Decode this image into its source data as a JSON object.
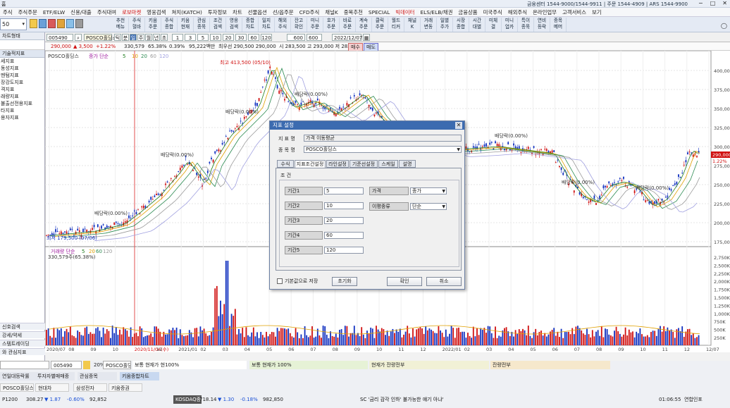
{
  "window": {
    "title": "홈",
    "center_info": "금융센터 1544-9000/1544-9911 | 주문 1544-4909 | ARS 1544-9900"
  },
  "menu": [
    "주식",
    "주식주문",
    "ETF/ELW",
    "신용/대출",
    "주식대여",
    "로보마켓",
    "영웅검색",
    "쳐치(KATCH)",
    "투자정보",
    "차트",
    "선물옵션",
    "선/옵주문",
    "CFD주식",
    "채널K",
    "중목추천",
    "SPECIAL",
    "빅데이터",
    "ELS/ELB/채권",
    "금융상품",
    "미국주식",
    "해외주식",
    "온라인업무",
    "고객서비스",
    "보기"
  ],
  "menu_red": [
    "로보마켓",
    "빅데이터"
  ],
  "toolbar": [
    {
      "l1": "추천",
      "l2": "메뉴"
    },
    {
      "l1": "주식",
      "l2": "혈바"
    },
    {
      "l1": "키움",
      "l2": "주문"
    },
    {
      "l1": "주식",
      "l2": "종합"
    },
    {
      "l1": "키움",
      "l2": "현재"
    },
    {
      "l1": "관심",
      "l2": "종목"
    },
    {
      "l1": "조건",
      "l2": "검색"
    },
    {
      "l1": "영웅",
      "l2": "검색"
    },
    {
      "l1": "종합",
      "l2": "차트"
    },
    {
      "l1": "일지",
      "l2": "차트"
    },
    {
      "l1": "해외",
      "l2": "주식"
    },
    {
      "l1": "잔고",
      "l2": "확인"
    },
    {
      "l1": "미니",
      "l2": "주문"
    },
    {
      "l1": "호가",
      "l2": "주문"
    },
    {
      "l1": "바로",
      "l2": "주문"
    },
    {
      "l1": "계속",
      "l2": "주문"
    },
    {
      "l1": "클릭",
      "l2": "주문"
    },
    {
      "l1": "월드",
      "l2": "티커"
    },
    {
      "l1": "채널",
      "l2": "K"
    },
    {
      "l1": "거래",
      "l2": "변동"
    },
    {
      "l1": "일별",
      "l2": "주가"
    },
    {
      "l1": "시장",
      "l2": "종합"
    },
    {
      "l1": "시간",
      "l2": "대별"
    },
    {
      "l1": "미체",
      "l2": "결"
    },
    {
      "l1": "미니",
      "l2": "업카"
    },
    {
      "l1": "특이",
      "l2": "종목"
    },
    {
      "l1": "연비",
      "l2": "등락"
    },
    {
      "l1": "종목",
      "l2": "메머"
    }
  ],
  "left_panel": {
    "head": "기술적지표",
    "items": [
      "세지표",
      "동성지표",
      "멘텀지표",
      "장강도지표",
      "격지표",
      "래량지표",
      "불출선전용지표",
      "타지표",
      "용자지표"
    ],
    "tab_top": "차트형태",
    "bottom": [
      "신호검색",
      "강세/약세",
      "스템트레이딩",
      "와 관심지표"
    ],
    "screen_no": "50"
  },
  "chart_controls": {
    "code": "005490",
    "stock_name": "POSCO홀딩스",
    "periods": [
      "틱",
      "분",
      "일",
      "주",
      "월",
      "년",
      "초"
    ],
    "intervals": [
      "1",
      "3",
      "5",
      "10",
      "20",
      "30",
      "60",
      "120"
    ],
    "count": "600",
    "count_total": "600",
    "date": "2022/12/07"
  },
  "price_bar": {
    "price": "290,000",
    "change": "▲ 3,500",
    "pct": "+1.22%",
    "volume": "330,579",
    "vol_ratio": "65.38%",
    "turnover": "0.39%",
    "amount": "95,222백만",
    "best_bid": "최우선 290,500 290,000",
    "ohl": "시 283,500 고 293,000 저 282,500",
    "buy_btn": "매수",
    "sell_btn": "매도"
  },
  "price_legend": {
    "name": "POSCO홀딩스",
    "type": "종가 단순",
    "ma": [
      "5",
      "10",
      "20",
      "60",
      "120"
    ]
  },
  "volume_legend": {
    "type": "거래량 단순",
    "ma": [
      "5",
      "20",
      "60",
      "120"
    ],
    "value": "330,579주(65.38%)"
  },
  "price_axis": [
    "400,000",
    "375,000",
    "350,000",
    "325,000",
    "300,000",
    "275,000",
    "250,000",
    "225,000",
    "200,000",
    "175,000"
  ],
  "volume_axis": [
    "2,750K",
    "2,500K",
    "2,250K",
    "2,000K",
    "1,750K",
    "1,500K",
    "1,250K",
    "1,000K",
    "750K",
    "500K",
    "250K"
  ],
  "current_price_tag": "290,000",
  "current_pct_tag": "1.22%",
  "date_axis": [
    "2020/07",
    "08",
    "09",
    "10",
    "2020/11/04(수)",
    "12",
    "2021/01",
    "02",
    "03",
    "04",
    "05",
    "06",
    "07",
    "08",
    "09",
    "10",
    "11",
    "12",
    "2022/01",
    "02",
    "03",
    "04",
    "05",
    "06",
    "07",
    "08",
    "09",
    "10",
    "11",
    "12",
    "12/07"
  ],
  "annotations": {
    "high": "최고 413,500 (05/10)",
    "low": "최저 179,500 (07/06)",
    "div": "배당락(0.00%)"
  },
  "dialog": {
    "title": "지표 설정",
    "name_label": "지 표 명",
    "name_value": "가격 이동평균",
    "stock_label": "종 목 명",
    "stock_value": "POSCO홀딩스",
    "tabs": [
      "수식",
      "지표조건설정",
      "라인설정",
      "기준선설정",
      "스케일",
      "설명"
    ],
    "cond_title": "조 건",
    "periods": [
      {
        "label": "기간1",
        "value": "5"
      },
      {
        "label": "기간2",
        "value": "10"
      },
      {
        "label": "기간3",
        "value": "20"
      },
      {
        "label": "기간4",
        "value": "60"
      },
      {
        "label": "기간5",
        "value": "120"
      }
    ],
    "price_label": "가격",
    "price_value": "종가",
    "ma_type_label": "이평종류",
    "ma_type_value": "단순",
    "save_default": "기본값으로 저장",
    "reset": "초기화",
    "ok": "확인",
    "cancel": "취소"
  },
  "bottom": {
    "code": "005490",
    "ratio": "20%",
    "stock": "POSCO홀딩",
    "strips": [
      {
        "text": "보통  현재가  현100%"
      },
      {
        "text": "보통  현재가  100%"
      },
      {
        "text": "현재가  잔량전부"
      },
      {
        "text": "잔량전부"
      }
    ],
    "tabs": [
      "연일대등락률",
      "투자자별매매종",
      "관심종목",
      "키움종합차트"
    ],
    "stocks": [
      "POSCO홀딩스",
      "현대차",
      "삼성전자",
      "키움증권"
    ],
    "ticker": [
      {
        "name": "P1200",
        "price": "308.27",
        "chg": "▼ 1.87",
        "pct": "-0.60%",
        "vol": "92,852"
      },
      {
        "name": "KOSDAQ종합",
        "price": "718.14",
        "chg": "▼ 1.30",
        "pct": "-0.18%",
        "vol": "982,850"
      }
    ],
    "news": "SC '금리 감각 인하' 불가능한 얘기 아냐'",
    "time1": "01:06:55",
    "source": "연합인포",
    "time2": "01:06:55"
  }
}
